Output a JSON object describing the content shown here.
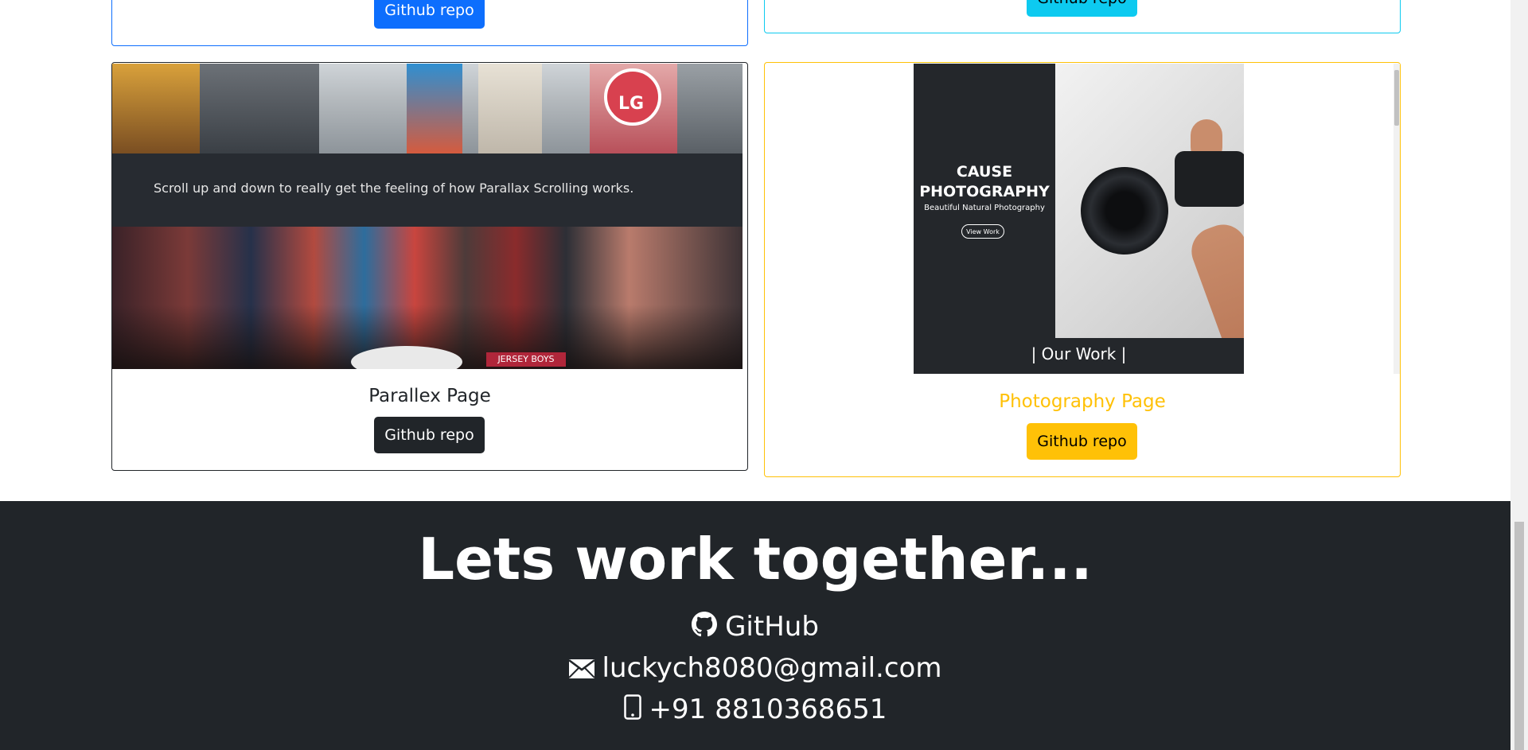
{
  "cards": {
    "top_left": {
      "button_label": "Github repo"
    },
    "top_right": {
      "button_label": "Github repo"
    },
    "parallax": {
      "preview_text": "Scroll up and down to really get the feeling of how Parallax Scrolling works.",
      "preview_logo": "LG",
      "preview_sign": "JERSEY BOYS",
      "title": "Parallex Page",
      "button_label": "Github repo"
    },
    "photography": {
      "preview_title": "CAUSE PHOTOGRAPHY",
      "preview_subtitle": "Beautiful Natural Photography",
      "preview_button": "View Work",
      "preview_footer": "| Our Work |",
      "title": "Photography Page",
      "button_label": "Github repo"
    }
  },
  "footer": {
    "heading": "Lets work together...",
    "github_label": "GitHub",
    "email": "luckych8080@gmail.com",
    "phone": "+91 8810368651"
  },
  "colors": {
    "primary": "#0d6efd",
    "info": "#0dcaf0",
    "dark": "#212529",
    "warning": "#ffc107"
  },
  "icons": [
    "github-icon",
    "envelope-icon",
    "phone-icon"
  ]
}
